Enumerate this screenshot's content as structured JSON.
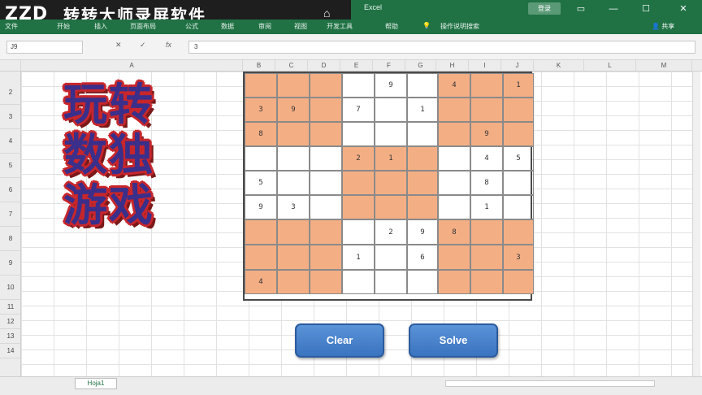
{
  "watermark": {
    "logo": "ZZD",
    "brand": "转转大师录屏软件",
    "home_icon": "home-icon"
  },
  "window": {
    "app": "Excel",
    "login": "登录",
    "controls": [
      "▭",
      "—",
      "☐",
      "✕"
    ]
  },
  "ribbon": {
    "tabs": [
      "文件",
      "开始",
      "插入",
      "页面布局",
      "公式",
      "数据",
      "审阅",
      "视图",
      "开发工具",
      "帮助",
      "操作说明搜索"
    ],
    "share": "共享"
  },
  "formula_bar": {
    "name_box": "J9",
    "cancel": "✕",
    "enter": "✓",
    "fx": "fx",
    "value": "3"
  },
  "columns": [
    "A",
    "B",
    "C",
    "D",
    "E",
    "F",
    "G",
    "H",
    "I",
    "J",
    "K",
    "L",
    "M"
  ],
  "rows": [
    "2",
    "3",
    "4",
    "5",
    "6",
    "7",
    "8",
    "9",
    "10",
    "11",
    "12",
    "13",
    "14"
  ],
  "title_art": [
    "玩转",
    "数独",
    "游戏"
  ],
  "sudoku": {
    "shade_color": "#f4ae84",
    "grid": [
      [
        "",
        "",
        "",
        "",
        "9",
        "",
        "4",
        "",
        "1"
      ],
      [
        "3",
        "9",
        "",
        "7",
        "",
        "1",
        "",
        "",
        ""
      ],
      [
        "8",
        "",
        "",
        "",
        "",
        "",
        "",
        "9",
        ""
      ],
      [
        "",
        "",
        "",
        "2",
        "1",
        "",
        "",
        "4",
        "5"
      ],
      [
        "5",
        "",
        "",
        "",
        "",
        "",
        "",
        "8",
        ""
      ],
      [
        "9",
        "3",
        "",
        "",
        "",
        "",
        "",
        "1",
        ""
      ],
      [
        "",
        "",
        "",
        "",
        "2",
        "9",
        "8",
        "",
        ""
      ],
      [
        "",
        "",
        "",
        "1",
        "",
        "6",
        "",
        "",
        "3"
      ],
      [
        "4",
        "",
        "",
        "",
        "",
        "",
        "",
        "",
        ""
      ]
    ]
  },
  "buttons": {
    "clear": "Clear",
    "solve": "Solve"
  },
  "sheet_tab": "Hoja1"
}
